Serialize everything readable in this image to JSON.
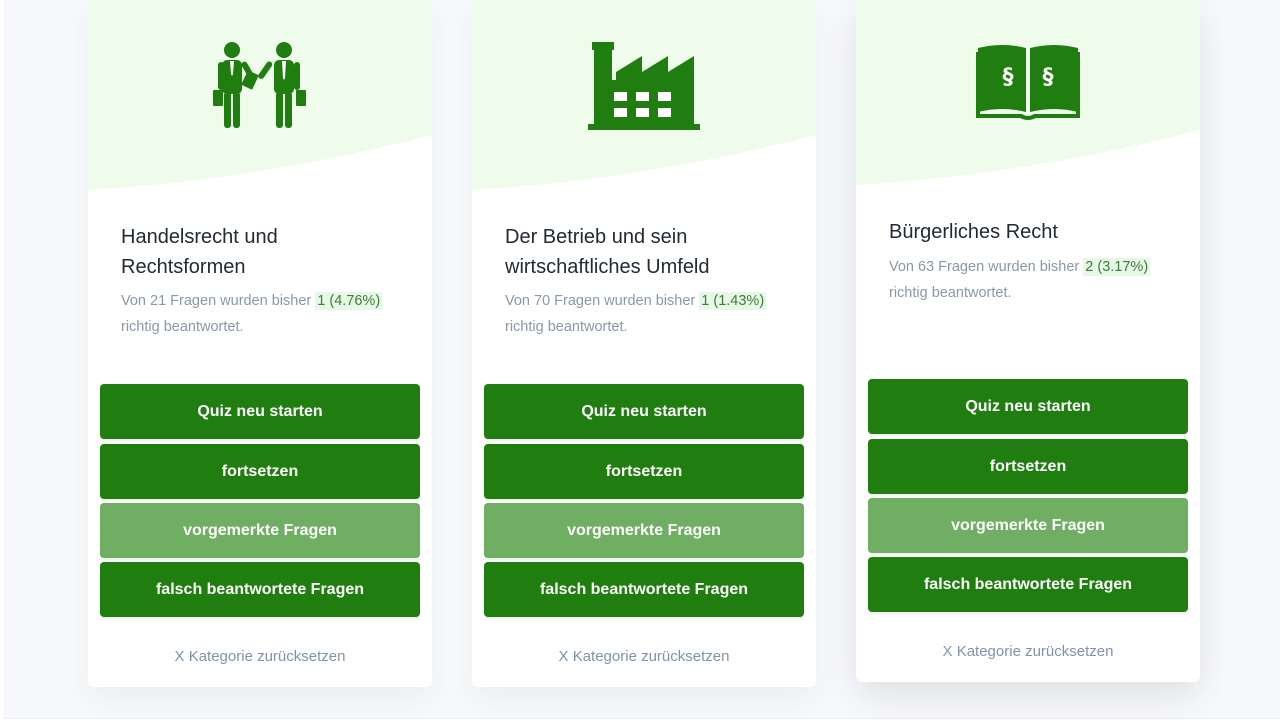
{
  "colors": {
    "accent": "#207d10",
    "accent_light": "#6fae63",
    "hero_bg": "#effcec",
    "highlight_bg": "#e8f8e6"
  },
  "cards": [
    {
      "icon": "businessmen-icon",
      "title_line1": "Handelsrecht und",
      "title_line2": "Rechtsformen",
      "stats_prefix": "Von 21 Fragen wurden bisher",
      "stats_value": "1 (4.76%)",
      "stats_suffix": "richtig beantwortet.",
      "restart_label": "Quiz neu starten",
      "continue_label": "fortsetzen",
      "marked_label": "vorgemerkte Fragen",
      "wrong_label": "falsch beantwortete Fragen",
      "reset_label": "X Kategorie zurücksetzen"
    },
    {
      "icon": "factory-icon",
      "title_line1": "Der Betrieb und sein",
      "title_line2": "wirtschaftliches Umfeld",
      "stats_prefix": "Von 70 Fragen wurden bisher",
      "stats_value": "1 (1.43%)",
      "stats_suffix": "richtig beantwortet.",
      "restart_label": "Quiz neu starten",
      "continue_label": "fortsetzen",
      "marked_label": "vorgemerkte Fragen",
      "wrong_label": "falsch beantwortete Fragen",
      "reset_label": "X Kategorie zurücksetzen"
    },
    {
      "icon": "law-book-icon",
      "title_line1": "Bürgerliches Recht",
      "stats_prefix": "Von 63 Fragen wurden bisher",
      "stats_value": "2 (3.17%)",
      "stats_suffix": "richtig beantwortet.",
      "restart_label": "Quiz neu starten",
      "continue_label": "fortsetzen",
      "marked_label": "vorgemerkte Fragen",
      "wrong_label": "falsch beantwortete Fragen",
      "reset_label": "X Kategorie zurücksetzen"
    }
  ]
}
